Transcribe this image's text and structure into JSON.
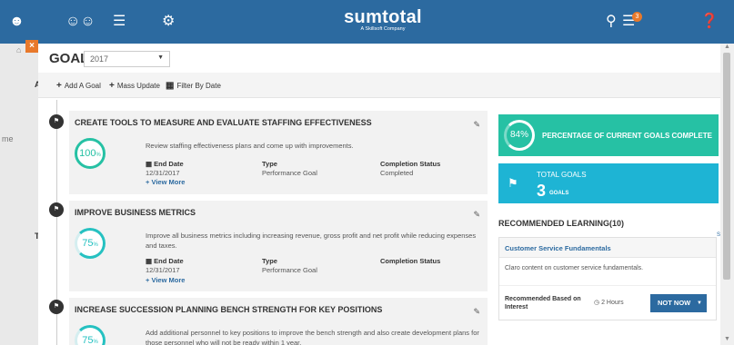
{
  "app": {
    "logo_text": "sumtotal",
    "logo_sub": "A Skillsoft Company",
    "notification_count": "3",
    "close_label": "×"
  },
  "background": {
    "fragment_a": "A",
    "fragment_me": "me",
    "fragment_t": "T"
  },
  "goals": {
    "title": "GOALS",
    "year": "2017"
  },
  "toolbar": {
    "add_goal": "Add A Goal",
    "mass_update": "Mass Update",
    "filter_by_date": "Filter By Date"
  },
  "goal_list": [
    {
      "title": "CREATE TOOLS TO MEASURE AND EVALUATE STAFFING EFFECTIVENESS",
      "percent": "100",
      "percent_symbol": "%",
      "description": "Review staffing effectiveness plans and come up with improvements.",
      "end_date_label": "End Date",
      "end_date": "12/31/2017",
      "type_label": "Type",
      "type": "Performance Goal",
      "status_label": "Completion Status",
      "status": "Completed",
      "view_more": "+ View More"
    },
    {
      "title": "IMPROVE BUSINESS METRICS",
      "percent": "75",
      "percent_symbol": "%",
      "description": "Improve all business metrics including increasing revenue, gross profit and net profit while reducing expenses and taxes.",
      "end_date_label": "End Date",
      "end_date": "12/31/2017",
      "type_label": "Type",
      "type": "Performance Goal",
      "status_label": "Completion Status",
      "status": "",
      "view_more": "+ View More"
    },
    {
      "title": "INCREASE SUCCESSION PLANNING BENCH STRENGTH FOR KEY POSITIONS",
      "percent": "75",
      "percent_symbol": "%",
      "description": "Add additional personnel to key positions to improve the bench strength and also create development plans for those personnel who will not be ready within 1 year."
    }
  ],
  "summary": {
    "percent_complete": "84%",
    "percent_label": "PERCENTAGE OF CURRENT GOALS COMPLETE",
    "total_label": "TOTAL GOALS",
    "total_value": "3",
    "total_unit": "GOALS"
  },
  "recommended": {
    "title": "RECOMMENDED LEARNING(10)",
    "see_all": "Se",
    "course_title": "Customer Service Fundamentals",
    "course_desc": "Claro content on customer service fundamentals.",
    "basis": "Recommended Based on Interest",
    "duration": "2 Hours",
    "not_now": "NOT NOW"
  },
  "colors": {
    "nav": "#2c6aa0",
    "teal": "#26c1a4",
    "cyan": "#1eb4d4",
    "orange": "#e8792b"
  },
  "icons": [
    "user-icon",
    "users-icon",
    "library-icon",
    "admin-icon",
    "search-icon",
    "tasks-icon",
    "help-icon",
    "home-icon",
    "flag-icon",
    "pencil-icon",
    "calendar-icon",
    "clock-icon"
  ]
}
